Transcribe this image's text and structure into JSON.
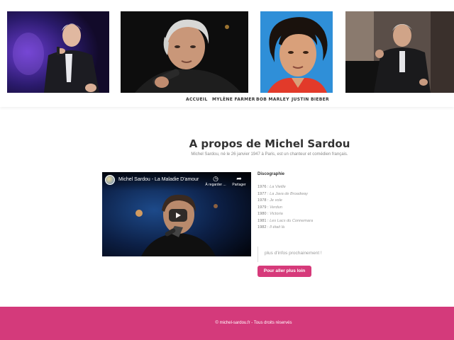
{
  "header": {
    "photos": [
      {
        "alt": "sardou-photo-stage"
      },
      {
        "alt": "sardou-photo-microphone"
      },
      {
        "alt": "sardou-photo-young"
      },
      {
        "alt": "sardou-photo-car"
      }
    ],
    "nav": [
      {
        "label": "ACCUEIL"
      },
      {
        "label": "MYLÈNE FARMER"
      },
      {
        "label": "BOB MARLEY"
      },
      {
        "label": "JUSTIN BIEBER"
      }
    ]
  },
  "main": {
    "title": "A propos de Michel Sardou",
    "subtitle": "Michel Sardou, né le 26 janvier 1947 à Paris, est un chanteur et comédien français.",
    "video": {
      "title": "Michel Sardou - La Maladie D'amour",
      "watch_later": "À regarder ...",
      "share": "Partager"
    },
    "discography": {
      "title": "Discographie",
      "items": [
        {
          "year": "1976",
          "album": "La Vieille"
        },
        {
          "year": "1977",
          "album": "La Java de Broadway"
        },
        {
          "year": "1978",
          "album": "Je vole"
        },
        {
          "year": "1979",
          "album": "Verdun"
        },
        {
          "year": "1980",
          "album": "Victoria"
        },
        {
          "year": "1981",
          "album": "Les Lacs du Connemara"
        },
        {
          "year": "1982",
          "album": "Il était là"
        }
      ]
    },
    "more_info": "plus d'infos prochainement !",
    "cta_label": "Pour aller plus loin"
  },
  "footer": {
    "text": "© michel-sardou.fr - Tous droits réservés"
  },
  "colors": {
    "accent": "#d63a7a",
    "footer_bg": "#d43a7b"
  }
}
